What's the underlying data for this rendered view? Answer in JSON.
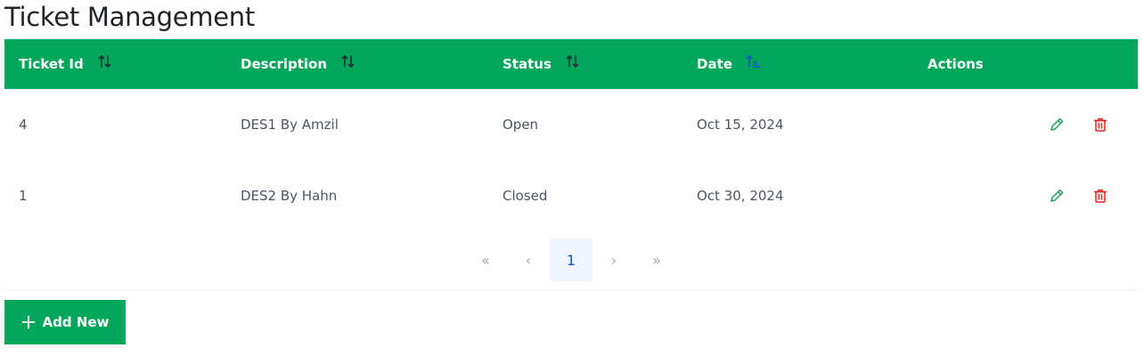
{
  "page": {
    "title": "Ticket Management"
  },
  "colors": {
    "accent": "#00a65a",
    "edit": "#1f9d55",
    "delete": "#e02424",
    "sort_active": "#1d4ed8",
    "sort_inactive": "#1f2937"
  },
  "table": {
    "columns": [
      {
        "label": "Ticket Id",
        "sort_icon": "sort-icon",
        "sorted": false
      },
      {
        "label": "Description",
        "sort_icon": "sort-icon",
        "sorted": false
      },
      {
        "label": "Status",
        "sort_icon": "sort-icon",
        "sorted": false
      },
      {
        "label": "Date",
        "sort_icon": "sort-ascending-icon",
        "sorted": true
      },
      {
        "label": "Actions"
      }
    ],
    "rows": [
      {
        "id": "4",
        "description": "DES1 By Amzil",
        "status": "Open",
        "date": "Oct 15, 2024"
      },
      {
        "id": "1",
        "description": "DES2 By Hahn",
        "status": "Closed",
        "date": "Oct 30, 2024"
      }
    ]
  },
  "pagination": {
    "first": "«",
    "prev": "‹",
    "current_page": "1",
    "next": "›",
    "last": "»"
  },
  "actions": {
    "add_new": "Add New"
  }
}
